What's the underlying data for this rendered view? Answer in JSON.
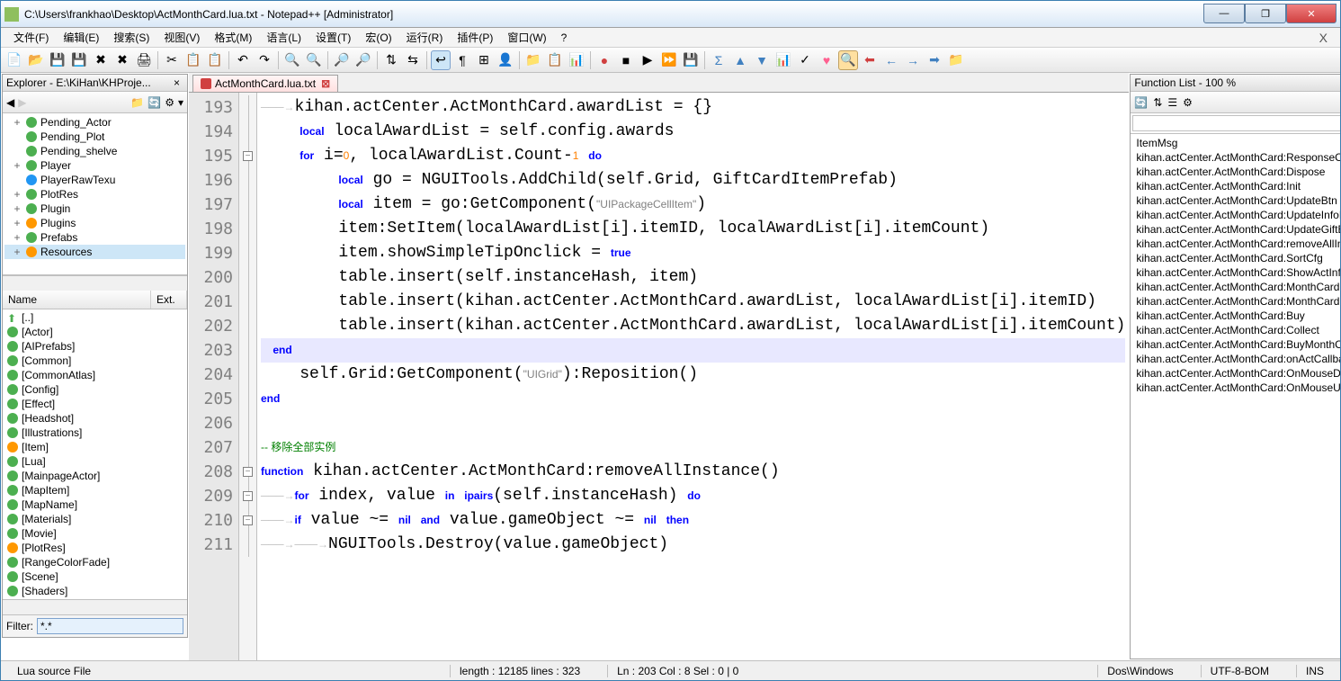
{
  "window": {
    "title": "C:\\Users\\frankhao\\Desktop\\ActMonthCard.lua.txt - Notepad++ [Administrator]"
  },
  "menu": [
    "文件(F)",
    "编辑(E)",
    "搜索(S)",
    "视图(V)",
    "格式(M)",
    "语言(L)",
    "设置(T)",
    "宏(O)",
    "运行(R)",
    "插件(P)",
    "窗口(W)",
    "?"
  ],
  "explorer": {
    "title": "Explorer - E:\\KiHan\\KHProje...",
    "tree": [
      {
        "exp": "+",
        "ico": "g",
        "label": "Pending_Actor"
      },
      {
        "exp": "",
        "ico": "g",
        "label": "Pending_Plot"
      },
      {
        "exp": "",
        "ico": "g",
        "label": "Pending_shelve"
      },
      {
        "exp": "+",
        "ico": "g",
        "label": "Player"
      },
      {
        "exp": "",
        "ico": "q",
        "label": "PlayerRawTexu"
      },
      {
        "exp": "+",
        "ico": "g",
        "label": "PlotRes"
      },
      {
        "exp": "+",
        "ico": "g",
        "label": "Plugin"
      },
      {
        "exp": "+",
        "ico": "e",
        "label": "Plugins"
      },
      {
        "exp": "+",
        "ico": "g",
        "label": "Prefabs"
      },
      {
        "exp": "+",
        "ico": "e",
        "label": "Resources",
        "sel": true
      }
    ],
    "list_header": {
      "name": "Name",
      "ext": "Ext."
    },
    "list": [
      {
        "ico": "up",
        "label": "[..]"
      },
      {
        "ico": "g",
        "label": "[Actor]"
      },
      {
        "ico": "g",
        "label": "[AIPrefabs]"
      },
      {
        "ico": "g",
        "label": "[Common]"
      },
      {
        "ico": "g",
        "label": "[CommonAtlas]"
      },
      {
        "ico": "g",
        "label": "[Config]"
      },
      {
        "ico": "g",
        "label": "[Effect]"
      },
      {
        "ico": "g",
        "label": "[Headshot]"
      },
      {
        "ico": "g",
        "label": "[Illustrations]"
      },
      {
        "ico": "e",
        "label": "[Item]"
      },
      {
        "ico": "g",
        "label": "[Lua]"
      },
      {
        "ico": "g",
        "label": "[MainpageActor]"
      },
      {
        "ico": "g",
        "label": "[MapItem]"
      },
      {
        "ico": "g",
        "label": "[MapName]"
      },
      {
        "ico": "g",
        "label": "[Materials]"
      },
      {
        "ico": "g",
        "label": "[Movie]"
      },
      {
        "ico": "e",
        "label": "[PlotRes]"
      },
      {
        "ico": "g",
        "label": "[RangeColorFade]"
      },
      {
        "ico": "g",
        "label": "[Scene]"
      },
      {
        "ico": "g",
        "label": "[Shaders]"
      }
    ],
    "filter_label": "Filter:",
    "filter_value": "*.*"
  },
  "tab_name": "ActMonthCard.lua.txt",
  "code_lines": [
    193,
    194,
    195,
    196,
    197,
    198,
    199,
    200,
    201,
    202,
    203,
    204,
    205,
    206,
    207,
    208,
    209,
    210,
    211
  ],
  "function_list": {
    "title": "Function List - 100 %",
    "items": [
      "ItemMsg",
      "kihan.actCenter.ActMonthCard:ResponseCallback",
      "kihan.actCenter.ActMonthCard:Dispose",
      "kihan.actCenter.ActMonthCard:Init",
      "kihan.actCenter.ActMonthCard:UpdateBtn",
      "kihan.actCenter.ActMonthCard:UpdateInfoDisplay",
      "kihan.actCenter.ActMonthCard:UpdateGiftBags",
      "kihan.actCenter.ActMonthCard:removeAllInstance",
      "kihan.actCenter.ActMonthCard.SortCfg",
      "kihan.actCenter.ActMonthCard:ShowActInfo",
      "kihan.actCenter.ActMonthCard:MonthCardClick",
      "kihan.actCenter.ActMonthCard:MonthCardBubble",
      "kihan.actCenter.ActMonthCard:Buy",
      "kihan.actCenter.ActMonthCard:Collect",
      "kihan.actCenter.ActMonthCard:BuyMonthCard",
      "kihan.actCenter.ActMonthCard:onActCallback",
      "kihan.actCenter.ActMonthCard:OnMouseDownBuyButton",
      "kihan.actCenter.ActMonthCard:OnMouseUpBuyButton"
    ]
  },
  "status": {
    "lang": "Lua source File",
    "length": "length : 12185    lines : 323",
    "pos": "Ln : 203    Col : 8    Sel : 0 | 0",
    "eol": "Dos\\Windows",
    "enc": "UTF-8-BOM",
    "mode": "INS"
  },
  "code_text": {
    "l193": "kihan.actCenter.ActMonthCard.awardList = {}",
    "l194_a": "local",
    "l194_b": " localAwardList = self.config.awards",
    "l195_a": "for",
    "l195_b": " i=",
    "l195_c": "0",
    "l195_d": ", localAwardList.Count-",
    "l195_e": "1",
    "l195_f": " ",
    "l195_g": "do",
    "l196_a": "local",
    "l196_b": " go = NGUITools.AddChild(self.Grid, GiftCardItemPrefab)",
    "l197_a": "local",
    "l197_b": " item = go:GetComponent(",
    "l197_c": "\"UIPackageCellItem\"",
    "l197_d": ")",
    "l198": "item:SetItem(localAwardList[i].itemID, localAwardList[i].itemCount)",
    "l199_a": "item.showSimpleTipOnclick = ",
    "l199_b": "true",
    "l200": "table.insert(self.instanceHash, item)",
    "l201": "table.insert(kihan.actCenter.ActMonthCard.awardList, localAwardList[i].itemID)",
    "l202": "table.insert(kihan.actCenter.ActMonthCard.awardList, localAwardList[i].itemCount)",
    "l203": "end",
    "l204_a": "self.Grid:GetComponent(",
    "l204_b": "\"UIGrid\"",
    "l204_c": "):Reposition()",
    "l205": "end",
    "l207": "-- 移除全部实例",
    "l208_a": "function",
    "l208_b": " kihan.actCenter.ActMonthCard:removeAllInstance()",
    "l209_a": "for",
    "l209_b": " index, value ",
    "l209_c": "in",
    "l209_d": " ",
    "l209_e": "ipairs",
    "l209_f": "(self.instanceHash) ",
    "l209_g": "do",
    "l210_a": "if",
    "l210_b": " value ~= ",
    "l210_c": "nil",
    "l210_d": " ",
    "l210_e": "and",
    "l210_f": " value.gameObject ~= ",
    "l210_g": "nil",
    "l210_h": " ",
    "l210_i": "then",
    "l211": "NGUITools.Destroy(value.gameObject)"
  }
}
